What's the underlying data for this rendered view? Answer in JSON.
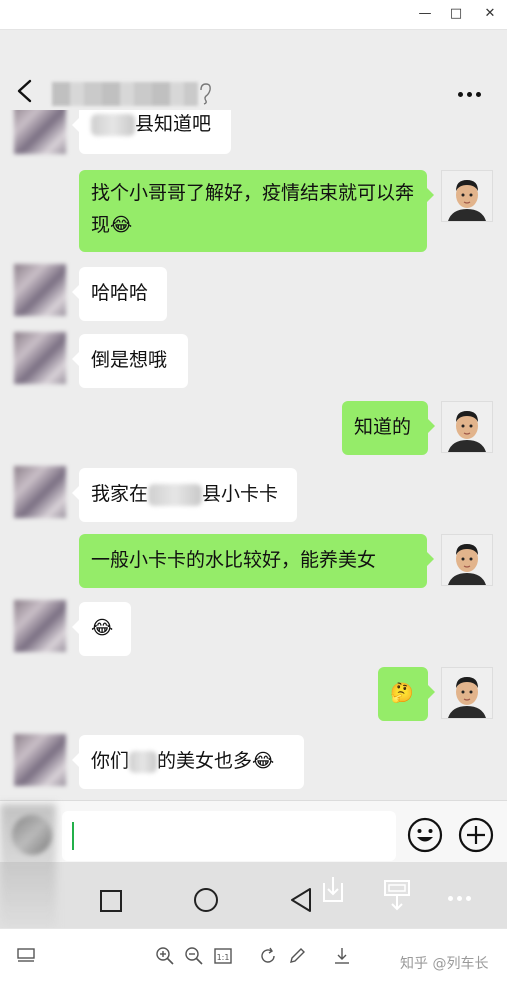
{
  "window": {
    "minimize_icon": "minimize-icon",
    "maximize_icon": "maximize-icon",
    "close_icon": "close-icon"
  },
  "chat": {
    "back_icon": "chevron-left-icon",
    "more_icon": "more-dots-icon"
  },
  "messages": [
    {
      "side": "left",
      "text_after": "县知道吧"
    },
    {
      "side": "right",
      "text": "找个小哥哥了解好，疫情结束就可以奔现",
      "emoji": "😂"
    },
    {
      "side": "left",
      "text": "哈哈哈"
    },
    {
      "side": "left",
      "text": "倒是想哦"
    },
    {
      "side": "right",
      "text": "知道的"
    },
    {
      "side": "left",
      "text_before": "我家在",
      "text_after": "县小卡卡"
    },
    {
      "side": "right",
      "text": "一般小卡卡的水比较好，能养美女"
    },
    {
      "side": "left",
      "emoji": "😂"
    },
    {
      "side": "right",
      "emoji": "🤔"
    },
    {
      "side": "left",
      "text_before": "你们",
      "text_after": "的美女也多",
      "emoji": "😂"
    }
  ],
  "input": {
    "emoji_button_icon": "smiley-icon",
    "add_button_icon": "plus-circle-icon"
  },
  "nav": {
    "recent_icon": "square-icon",
    "home_icon": "circle-icon",
    "back_icon": "triangle-back-icon"
  },
  "viewer": {
    "watermark": "知乎 @列车长"
  }
}
